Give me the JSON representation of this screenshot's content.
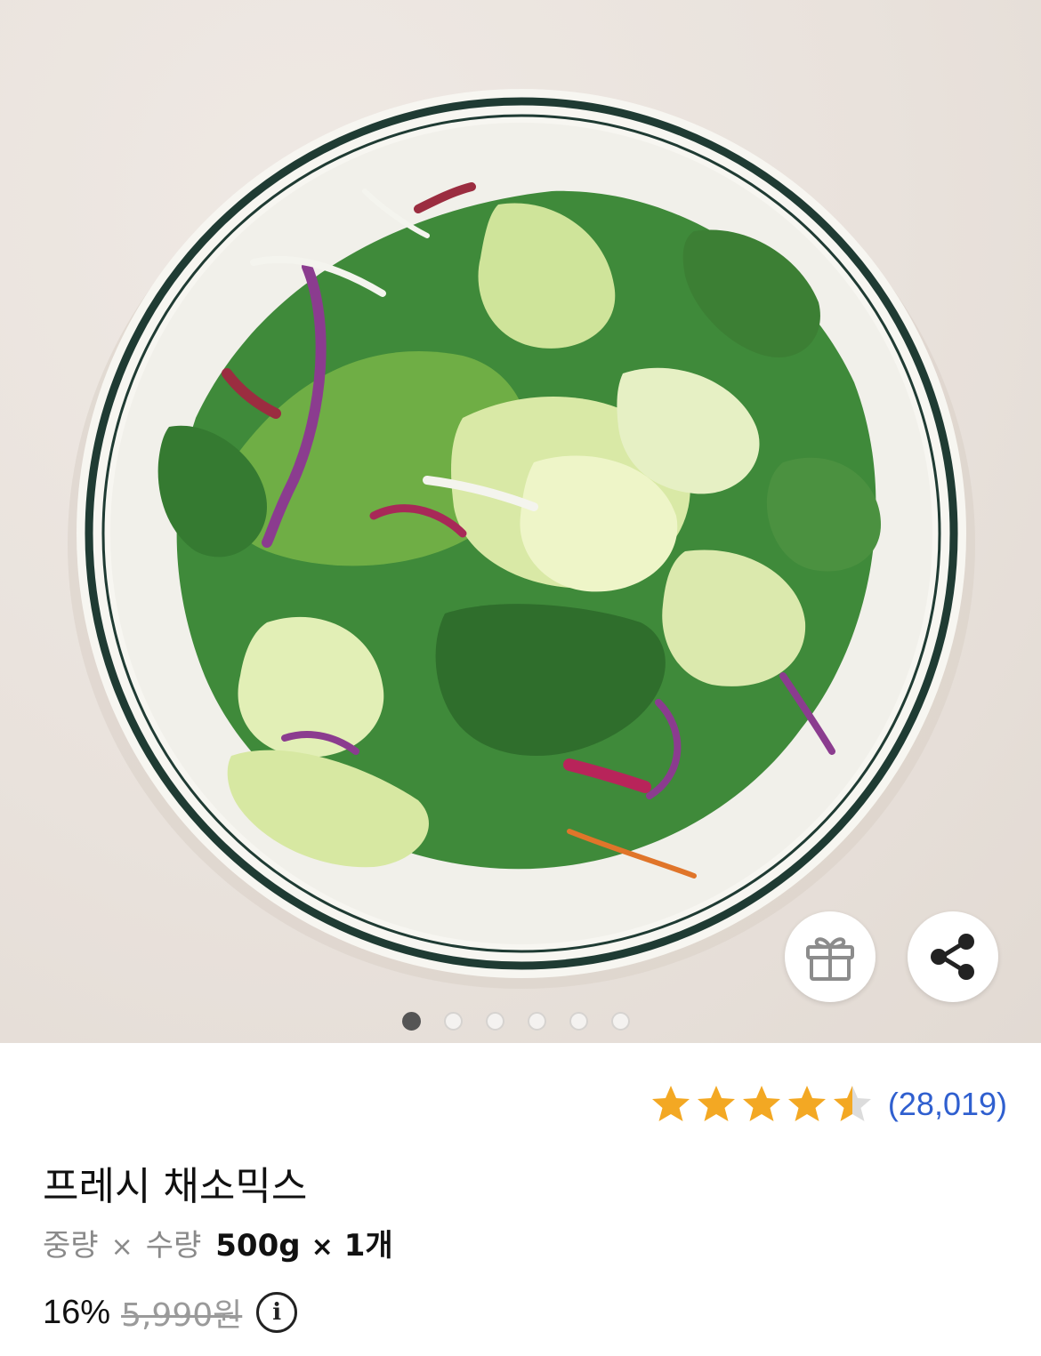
{
  "gallery": {
    "image_alt": "프레시 채소믹스",
    "page_count": 6,
    "active_index": 0
  },
  "actions": {
    "gift_icon": "gift-icon",
    "share_icon": "share-icon"
  },
  "rating": {
    "score": 4.5,
    "max": 5,
    "count_text": "(28,019)",
    "star_color": "#f3a823",
    "empty_color": "#dcdcdc"
  },
  "product": {
    "title": "프레시 채소믹스",
    "spec_label_weight": "중량",
    "spec_times": "×",
    "spec_label_qty": "수량",
    "spec_weight": "500g",
    "spec_qty": "1개"
  },
  "price": {
    "discount": "16%",
    "original": "5,990원",
    "info_icon": "info-icon",
    "info_glyph": "i"
  }
}
